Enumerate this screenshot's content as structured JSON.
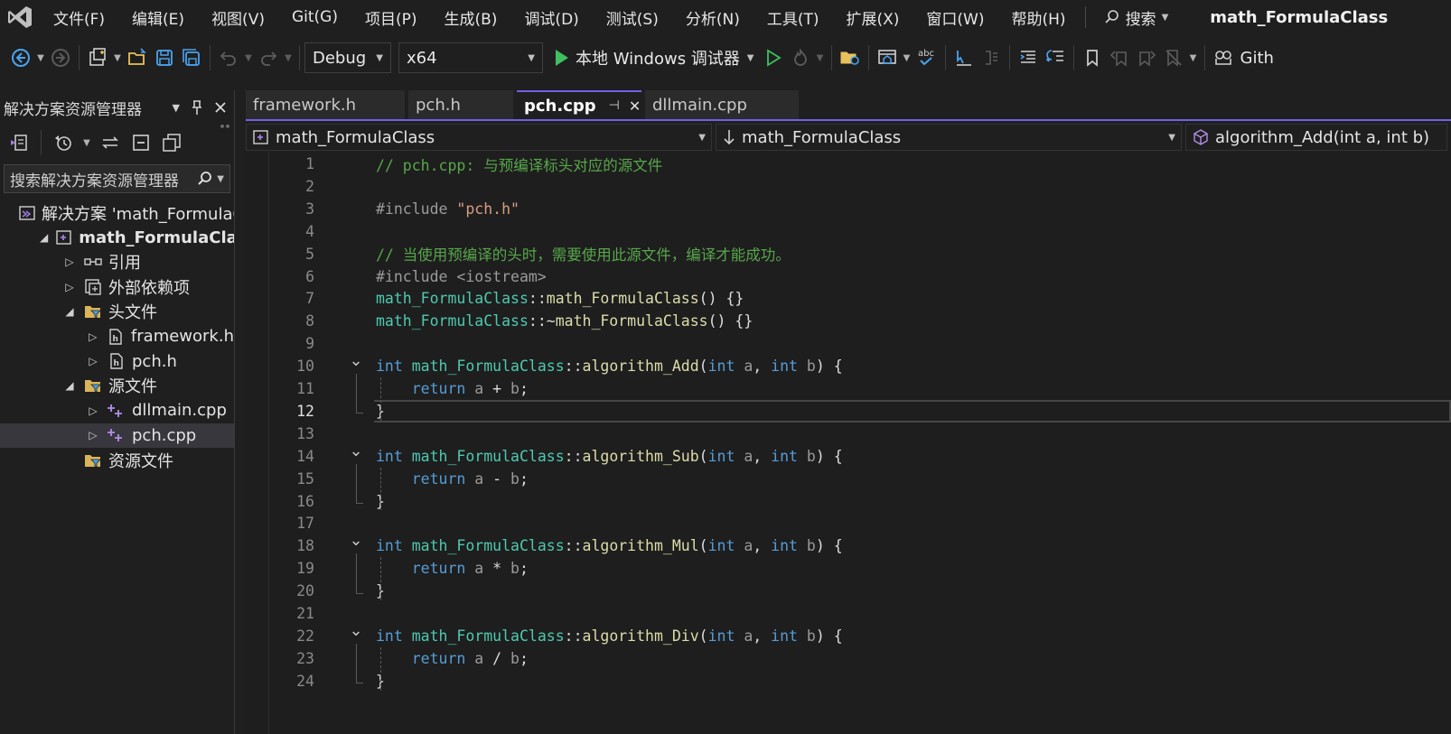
{
  "menu": {
    "items": [
      "文件(F)",
      "编辑(E)",
      "视图(V)",
      "Git(G)",
      "项目(P)",
      "生成(B)",
      "调试(D)",
      "测试(S)",
      "分析(N)",
      "工具(T)",
      "扩展(X)",
      "窗口(W)",
      "帮助(H)"
    ],
    "search_label": "搜索",
    "solution_name": "math_FormulaClass"
  },
  "toolbar": {
    "configuration": "Debug",
    "platform": "x64",
    "run_label": "本地 Windows 调试器",
    "git_label": "Gith"
  },
  "solution_explorer": {
    "title": "解决方案资源管理器",
    "search_placeholder": "搜索解决方案资源管理器",
    "tree": [
      {
        "label": "解决方案 'math_FormulaC",
        "icon": "solution-icon",
        "indent": 0,
        "twisty": "",
        "bold": false,
        "selected": false
      },
      {
        "label": "math_FormulaClass",
        "icon": "cpp-project-icon",
        "indent": 1,
        "twisty": "expanded",
        "bold": true,
        "selected": false
      },
      {
        "label": "引用",
        "icon": "references-icon",
        "indent": 2,
        "twisty": "collapsed",
        "bold": false,
        "selected": false
      },
      {
        "label": "外部依赖项",
        "icon": "external-dependencies-icon",
        "indent": 2,
        "twisty": "collapsed",
        "bold": false,
        "selected": false
      },
      {
        "label": "头文件",
        "icon": "filter-folder-icon",
        "indent": 2,
        "twisty": "expanded",
        "bold": false,
        "selected": false
      },
      {
        "label": "framework.h",
        "icon": "header-file-icon",
        "indent": 3,
        "twisty": "collapsed",
        "bold": false,
        "selected": false
      },
      {
        "label": "pch.h",
        "icon": "header-file-icon",
        "indent": 3,
        "twisty": "collapsed",
        "bold": false,
        "selected": false
      },
      {
        "label": "源文件",
        "icon": "filter-folder-icon",
        "indent": 2,
        "twisty": "expanded",
        "bold": false,
        "selected": false
      },
      {
        "label": "dllmain.cpp",
        "icon": "cpp-file-icon",
        "indent": 3,
        "twisty": "collapsed",
        "bold": false,
        "selected": false
      },
      {
        "label": "pch.cpp",
        "icon": "cpp-file-icon",
        "indent": 3,
        "twisty": "collapsed",
        "bold": false,
        "selected": true
      },
      {
        "label": "资源文件",
        "icon": "filter-folder-icon",
        "indent": 2,
        "twisty": "",
        "bold": false,
        "selected": false
      }
    ]
  },
  "tabs": [
    {
      "label": "framework.h",
      "active": false
    },
    {
      "label": "pch.h",
      "active": false
    },
    {
      "label": "pch.cpp",
      "active": true
    },
    {
      "label": "dllmain.cpp",
      "active": false
    }
  ],
  "navbar": {
    "project": "math_FormulaClass",
    "scope": "math_FormulaClass",
    "member": "algorithm_Add(int a, int b)"
  },
  "editor": {
    "current_line": 12,
    "lines": [
      {
        "n": "1",
        "fold": "",
        "tokens": [
          [
            "c-cmt",
            "// pch.cpp: 与预编译标头对应的源文件"
          ]
        ]
      },
      {
        "n": "2",
        "fold": "",
        "tokens": []
      },
      {
        "n": "3",
        "fold": "",
        "tokens": [
          [
            "c-pre",
            "#include "
          ],
          [
            "c-str",
            "\"pch.h\""
          ]
        ]
      },
      {
        "n": "4",
        "fold": "",
        "tokens": []
      },
      {
        "n": "5",
        "fold": "",
        "tokens": [
          [
            "c-cmt",
            "// 当使用预编译的头时，需要使用此源文件，编译才能成功。"
          ]
        ]
      },
      {
        "n": "6",
        "fold": "",
        "tokens": [
          [
            "c-pre",
            "#include <iostream>"
          ]
        ]
      },
      {
        "n": "7",
        "fold": "",
        "tokens": [
          [
            "c-cls",
            "math_FormulaClass"
          ],
          [
            "c-txt",
            "::"
          ],
          [
            "c-fn",
            "math_FormulaClass"
          ],
          [
            "c-txt",
            "() {}"
          ]
        ]
      },
      {
        "n": "8",
        "fold": "",
        "tokens": [
          [
            "c-cls",
            "math_FormulaClass"
          ],
          [
            "c-txt",
            "::~"
          ],
          [
            "c-fn",
            "math_FormulaClass"
          ],
          [
            "c-txt",
            "() {}"
          ]
        ]
      },
      {
        "n": "9",
        "fold": "",
        "tokens": []
      },
      {
        "n": "10",
        "fold": "open",
        "tokens": [
          [
            "c-kw",
            "int "
          ],
          [
            "c-cls",
            "math_FormulaClass"
          ],
          [
            "c-txt",
            "::"
          ],
          [
            "c-fn",
            "algorithm_Add"
          ],
          [
            "c-txt",
            "("
          ],
          [
            "c-kw",
            "int "
          ],
          [
            "c-prm",
            "a"
          ],
          [
            "c-txt",
            ", "
          ],
          [
            "c-kw",
            "int "
          ],
          [
            "c-prm",
            "b"
          ],
          [
            "c-txt",
            ") {"
          ]
        ]
      },
      {
        "n": "11",
        "fold": "",
        "tokens": [
          [
            "c-kw",
            "    return "
          ],
          [
            "c-prm",
            "a"
          ],
          [
            "c-txt",
            " + "
          ],
          [
            "c-prm",
            "b"
          ],
          [
            "c-txt",
            ";"
          ]
        ]
      },
      {
        "n": "12",
        "fold": "",
        "tokens": [
          [
            "c-txt",
            "}"
          ]
        ]
      },
      {
        "n": "13",
        "fold": "",
        "tokens": []
      },
      {
        "n": "14",
        "fold": "open",
        "tokens": [
          [
            "c-kw",
            "int "
          ],
          [
            "c-cls",
            "math_FormulaClass"
          ],
          [
            "c-txt",
            "::"
          ],
          [
            "c-fn",
            "algorithm_Sub"
          ],
          [
            "c-txt",
            "("
          ],
          [
            "c-kw",
            "int "
          ],
          [
            "c-prm",
            "a"
          ],
          [
            "c-txt",
            ", "
          ],
          [
            "c-kw",
            "int "
          ],
          [
            "c-prm",
            "b"
          ],
          [
            "c-txt",
            ") {"
          ]
        ]
      },
      {
        "n": "15",
        "fold": "",
        "tokens": [
          [
            "c-kw",
            "    return "
          ],
          [
            "c-prm",
            "a"
          ],
          [
            "c-txt",
            " - "
          ],
          [
            "c-prm",
            "b"
          ],
          [
            "c-txt",
            ";"
          ]
        ]
      },
      {
        "n": "16",
        "fold": "",
        "tokens": [
          [
            "c-txt",
            "}"
          ]
        ]
      },
      {
        "n": "17",
        "fold": "",
        "tokens": []
      },
      {
        "n": "18",
        "fold": "open",
        "tokens": [
          [
            "c-kw",
            "int "
          ],
          [
            "c-cls",
            "math_FormulaClass"
          ],
          [
            "c-txt",
            "::"
          ],
          [
            "c-fn",
            "algorithm_Mul"
          ],
          [
            "c-txt",
            "("
          ],
          [
            "c-kw",
            "int "
          ],
          [
            "c-prm",
            "a"
          ],
          [
            "c-txt",
            ", "
          ],
          [
            "c-kw",
            "int "
          ],
          [
            "c-prm",
            "b"
          ],
          [
            "c-txt",
            ") {"
          ]
        ]
      },
      {
        "n": "19",
        "fold": "",
        "tokens": [
          [
            "c-kw",
            "    return "
          ],
          [
            "c-prm",
            "a"
          ],
          [
            "c-txt",
            " * "
          ],
          [
            "c-prm",
            "b"
          ],
          [
            "c-txt",
            ";"
          ]
        ]
      },
      {
        "n": "20",
        "fold": "",
        "tokens": [
          [
            "c-txt",
            "}"
          ]
        ]
      },
      {
        "n": "21",
        "fold": "",
        "tokens": []
      },
      {
        "n": "22",
        "fold": "open",
        "tokens": [
          [
            "c-kw",
            "int "
          ],
          [
            "c-cls",
            "math_FormulaClass"
          ],
          [
            "c-txt",
            "::"
          ],
          [
            "c-fn",
            "algorithm_Div"
          ],
          [
            "c-txt",
            "("
          ],
          [
            "c-kw",
            "int "
          ],
          [
            "c-prm",
            "a"
          ],
          [
            "c-txt",
            ", "
          ],
          [
            "c-kw",
            "int "
          ],
          [
            "c-prm",
            "b"
          ],
          [
            "c-txt",
            ") {"
          ]
        ]
      },
      {
        "n": "23",
        "fold": "",
        "tokens": [
          [
            "c-kw",
            "    return "
          ],
          [
            "c-prm",
            "a"
          ],
          [
            "c-txt",
            " / "
          ],
          [
            "c-prm",
            "b"
          ],
          [
            "c-txt",
            ";"
          ]
        ]
      },
      {
        "n": "24",
        "fold": "",
        "tokens": [
          [
            "c-txt",
            "}"
          ]
        ]
      }
    ]
  },
  "colors": {
    "accent": "#7160e8",
    "run_green": "#3fbf5f",
    "comment": "#57a64a",
    "keyword": "#569cd6",
    "class": "#4ec9b0",
    "function": "#dcdcaa",
    "string": "#d69d85"
  }
}
